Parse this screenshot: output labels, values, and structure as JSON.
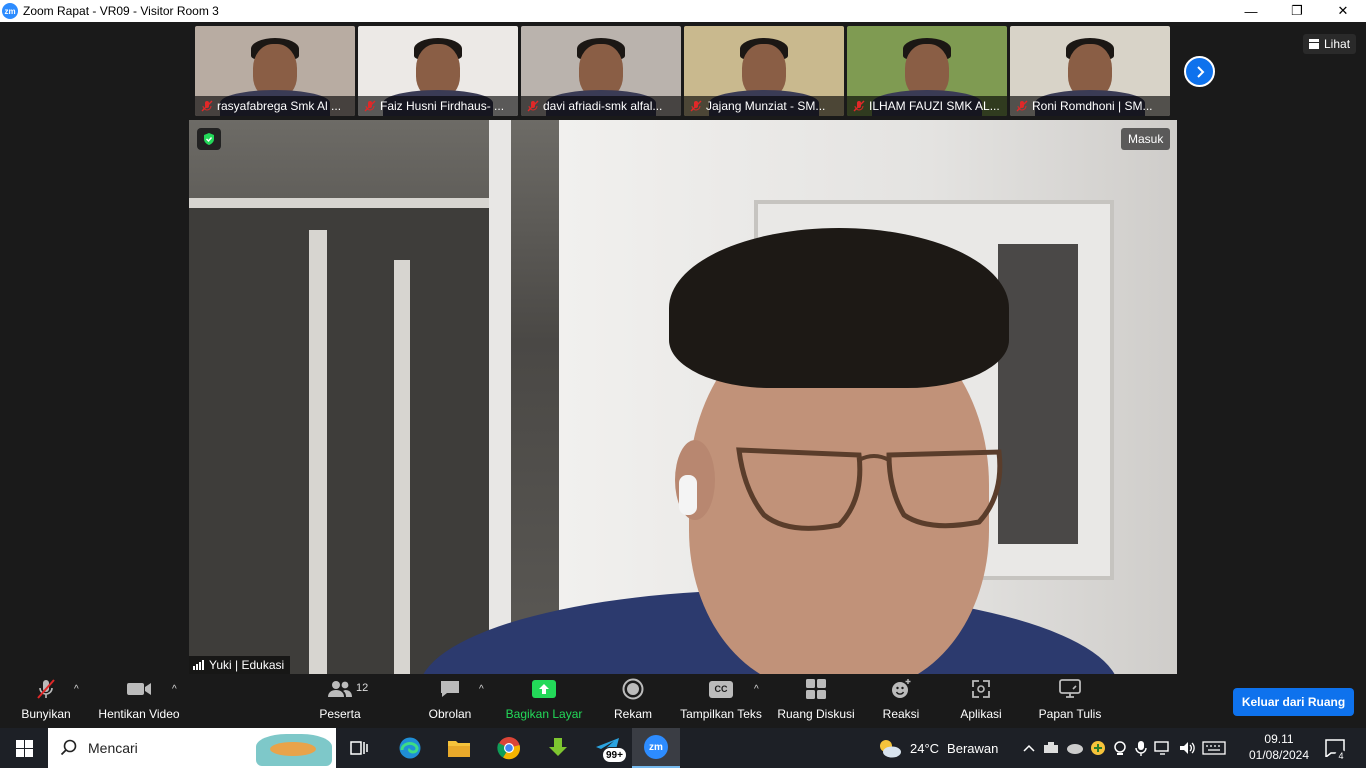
{
  "window": {
    "title": "Zoom Rapat - VR09 - Visitor Room 3",
    "logo_text": "zm",
    "minimize": "—",
    "restore": "❐",
    "close": "✕"
  },
  "gallery": {
    "view_label": "Lihat",
    "participants": [
      {
        "name": "rasyafabrega Smk Al ...",
        "bg": "#b8aca2",
        "muted": true
      },
      {
        "name": "Faiz Husni Firdhaus- ...",
        "bg": "#ece9e6",
        "muted": true
      },
      {
        "name": "davi afriadi-smk alfal...",
        "bg": "#bab3ad",
        "muted": true
      },
      {
        "name": "Jajang Munziat - SM...",
        "bg": "#c9b98e",
        "muted": true
      },
      {
        "name": "ILHAM FAUZI SMK AL...",
        "bg": "#7f9b52",
        "muted": true
      },
      {
        "name": "Roni Romdhoni | SM...",
        "bg": "#d8d3c8",
        "muted": true
      }
    ]
  },
  "main_video": {
    "name": "Yuki | Edukasi",
    "badge": "Masuk"
  },
  "toolbar": {
    "mute_label": "Bunyikan",
    "video_label": "Hentikan Video",
    "participants_label": "Peserta",
    "participants_count": "12",
    "chat_label": "Obrolan",
    "share_label": "Bagikan Layar",
    "record_label": "Rekam",
    "captions_label": "Tampilkan Teks",
    "captions_icon_text": "CC",
    "breakout_label": "Ruang Diskusi",
    "reactions_label": "Reaksi",
    "apps_label": "Aplikasi",
    "whiteboard_label": "Papan Tulis",
    "leave_label": "Keluar dari Ruang"
  },
  "colors": {
    "accent": "#0e72ed",
    "share_green": "#23d959",
    "muted_red": "#e02828"
  },
  "taskbar": {
    "search_placeholder": "Mencari",
    "weather_temp": "24°C",
    "weather_text": "Berawan",
    "time": "09.11",
    "date": "01/08/2024",
    "notif_count": "4",
    "badge_99": "99+",
    "zoom_icon_text": "zm"
  }
}
